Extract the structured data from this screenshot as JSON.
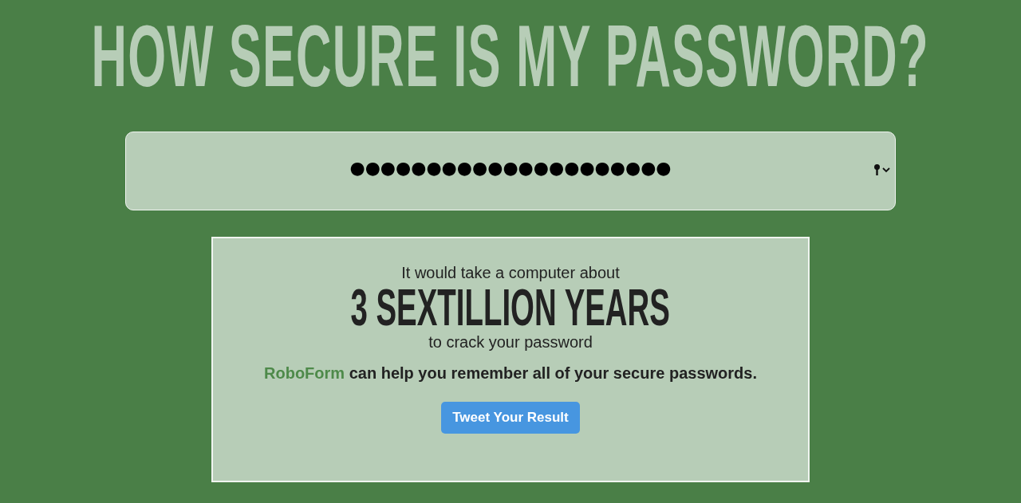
{
  "title": "HOW SECURE IS MY PASSWORD?",
  "password_field": {
    "value": "●●●●●●●●●●●●●●●●●●●●●"
  },
  "result": {
    "intro": "It would take a computer about",
    "duration": "3 SEXTILLION YEARS",
    "outro": "to crack your password",
    "promo": {
      "link": "RoboForm",
      "text": "can help you remember all of your secure passwords."
    },
    "button": "Tweet Your Result"
  }
}
